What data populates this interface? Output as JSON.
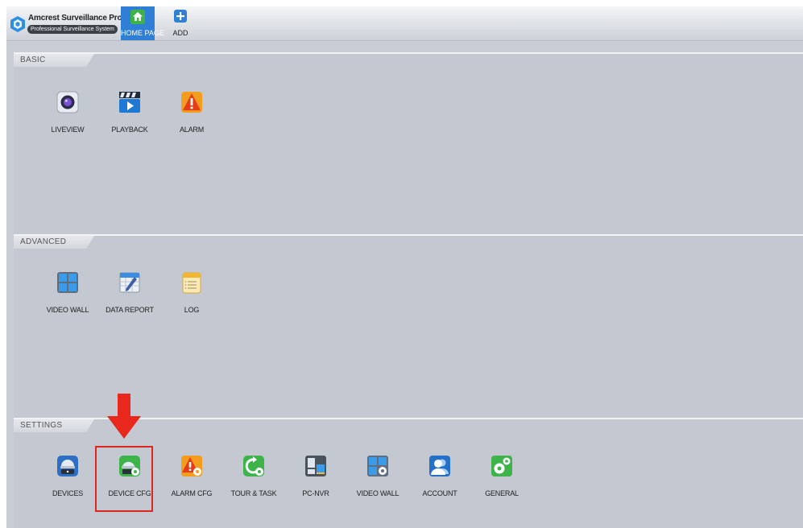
{
  "app": {
    "title": "Amcrest Surveillance Pro",
    "subtitle": "Professional Surveillance System"
  },
  "nav": {
    "tabs": [
      {
        "label": "HOME PAGE",
        "icon": "home-icon",
        "active": true
      },
      {
        "label": "ADD",
        "icon": "add-icon",
        "active": false
      }
    ]
  },
  "sections": [
    {
      "title": "BASIC",
      "items": [
        {
          "label": "LIVEVIEW",
          "icon": "camera-lens-icon"
        },
        {
          "label": "PLAYBACK",
          "icon": "playback-clapper-icon"
        },
        {
          "label": "ALARM",
          "icon": "alarm-warning-icon"
        }
      ]
    },
    {
      "title": "ADVANCED",
      "items": [
        {
          "label": "VIDEO WALL",
          "icon": "video-wall-grid-icon"
        },
        {
          "label": "DATA REPORT",
          "icon": "data-report-icon"
        },
        {
          "label": "LOG",
          "icon": "log-notepad-icon"
        }
      ]
    },
    {
      "title": "SETTINGS",
      "items": [
        {
          "label": "DEVICES",
          "icon": "devices-dome-camera-icon"
        },
        {
          "label": "DEVICE CFG",
          "icon": "device-cfg-gear-icon",
          "highlighted": true
        },
        {
          "label": "ALARM CFG",
          "icon": "alarm-cfg-gear-icon"
        },
        {
          "label": "TOUR & TASK",
          "icon": "tour-task-icon"
        },
        {
          "label": "PC-NVR",
          "icon": "pc-nvr-icon"
        },
        {
          "label": "VIDEO WALL",
          "icon": "video-wall-cfg-icon"
        },
        {
          "label": "ACCOUNT",
          "icon": "account-user-icon"
        },
        {
          "label": "GENERAL",
          "icon": "general-gears-icon"
        }
      ]
    }
  ],
  "colors": {
    "accent": "#2f7fd6",
    "highlight": "#e0251b",
    "background": "#c3c8d1"
  }
}
